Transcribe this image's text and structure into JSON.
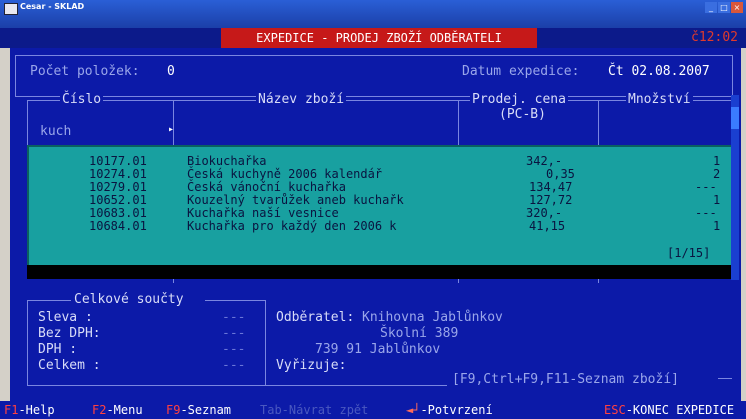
{
  "window": {
    "title": "Cesar - SKLAD",
    "controls": [
      "_",
      "□",
      "×"
    ]
  },
  "header": {
    "title": "EXPEDICE - PRODEJ ZBOŽÍ ODBĚRATELI",
    "clock": "č12:02"
  },
  "top": {
    "count_label": "Počet položek:",
    "count_value": "0",
    "date_label": "Datum expedice:",
    "date_value": "Čt 02.08.2007"
  },
  "columns": {
    "cislo": "Číslo",
    "nazev": "Název zboží",
    "cena": "Prodej. cena",
    "cena_sub": "(PC-B)",
    "mnozstvi": "Množství"
  },
  "search": {
    "value": "kuch",
    "marker": "▸"
  },
  "popup": {
    "rows": [
      {
        "cislo": "10177.01",
        "nazev": "Biokuchařka",
        "cena": "342,-",
        "mnozstvi": "1"
      },
      {
        "cislo": "10274.01",
        "nazev": "Česká kuchyně 2006  kalendář",
        "cena": "0,35",
        "mnozstvi": "2"
      },
      {
        "cislo": "10279.01",
        "nazev": "Česká vánoční kuchařka",
        "cena": "134,47",
        "mnozstvi": "---"
      },
      {
        "cislo": "10652.01",
        "nazev": "Kouzelný tvarůžek aneb kuchařk",
        "cena": "127,72",
        "mnozstvi": "1"
      },
      {
        "cislo": "10683.01",
        "nazev": "Kuchařka naší vesnice",
        "cena": "320,-",
        "mnozstvi": "---"
      },
      {
        "cislo": "10684.01",
        "nazev": "Kuchařka pro každý den 2006  k",
        "cena": "41,15",
        "mnozstvi": "1"
      }
    ],
    "page": "[1/15]"
  },
  "totals": {
    "title": "Celkové součty",
    "sleva_label": "Sleva   :",
    "sleva_value": "---",
    "bezdph_label": "Bez DPH:",
    "bezdph_value": "---",
    "dph_label": "DPH     :",
    "dph_value": "---",
    "celkem_label": "Celkem :",
    "celkem_value": "---"
  },
  "customer": {
    "label": "Odběratel:",
    "line1": "Knihovna Jablůnkov",
    "line2": "Školní 389",
    "line3": "739 91 Jablůnkov",
    "handler_label": "Vyřizuje:",
    "hint": "[F9,Ctrl+F9,F11-Seznam zboží]"
  },
  "statusbar": {
    "f1_key": "F1",
    "f1_label": "-Help",
    "f2_key": "F2",
    "f2_label": "-Menu",
    "f9_key": "F9",
    "f9_label": "-Seznam",
    "tab_label": "Tab-Návrat zpět",
    "enter_key": "◄┘",
    "enter_label": "-Potvrzení",
    "esc_key": "ESC",
    "esc_label": "-KONEC EXPEDICE"
  },
  "colors": {
    "background": "#0c1aa8",
    "popup": "#18a0a0",
    "title_red": "#c61919"
  }
}
